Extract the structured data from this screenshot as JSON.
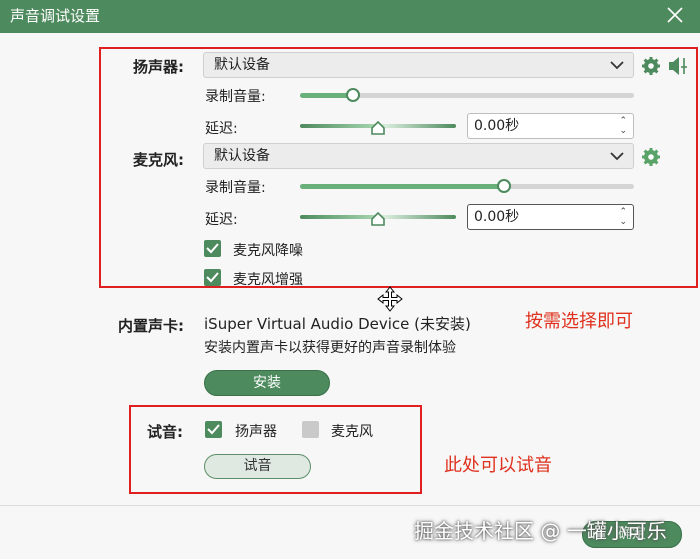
{
  "window": {
    "title": "声音调试设置"
  },
  "speaker": {
    "label": "扬声器:",
    "device": "默认设备",
    "volume_label": "录制音量:",
    "volume_level": 0.16,
    "delay_label": "延迟:",
    "delay_value": "0.00秒"
  },
  "microphone": {
    "label": "麦克风:",
    "device": "默认设备",
    "volume_label": "录制音量:",
    "volume_level": 0.61,
    "delay_label": "延迟:",
    "delay_value": "0.00秒",
    "noise_reduction": {
      "label": "麦克风降噪",
      "checked": true
    },
    "enhance": {
      "label": "麦克风增强",
      "checked": true
    }
  },
  "soundcard": {
    "label": "内置声卡:",
    "device_name": "iSuper Virtual Audio Device (未安装)",
    "hint": "安装内置声卡以获得更好的声音录制体验",
    "install_label": "安装"
  },
  "test": {
    "label": "试音:",
    "speaker": {
      "label": "扬声器",
      "checked": true
    },
    "mic": {
      "label": "麦克风",
      "checked": false
    },
    "button_label": "试音"
  },
  "annotations": {
    "choose": "按需选择即可",
    "test": "此处可以试音"
  },
  "footer": {
    "ok_label": "确定"
  },
  "watermark": "掘金技术社区 @ 一罐小可乐",
  "colors": {
    "brand": "#4d8a5d",
    "annotation": "#e02020"
  }
}
